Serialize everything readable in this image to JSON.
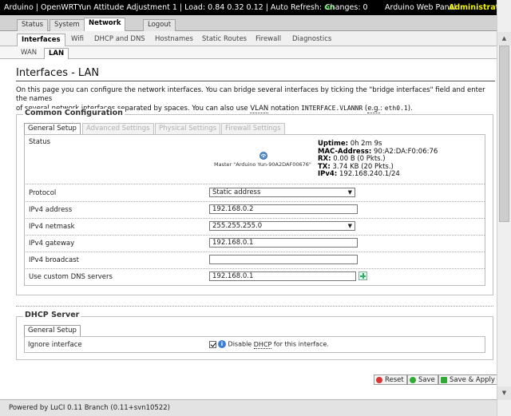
{
  "header": {
    "left_text": "Arduino | OpenWRTYun Attitude Adjustment 1 | Load: 0.84 0.32 0.12 | Auto Refresh: ",
    "auto_refresh": "on",
    "changes": "Changes: 0",
    "panel_name": "Arduino Web Panel",
    "admin_label": "Administration"
  },
  "main_tabs": [
    "Status",
    "System",
    "Network",
    "Logout"
  ],
  "sub_tabs": [
    "Interfaces",
    "Wifi",
    "DHCP and DNS",
    "Hostnames",
    "Static Routes",
    "Firewall",
    "Diagnostics"
  ],
  "iface_tabs": [
    "WAN",
    "LAN"
  ],
  "page": {
    "title": "Interfaces - LAN",
    "desc_line1": "On this page you can configure the network interfaces. You can bridge several interfaces by ticking the \"bridge interfaces\" field and enter the names",
    "desc_line2a": "of several network interfaces separated by spaces. You can also use ",
    "desc_vlan": "VLAN",
    "desc_line2b": " notation ",
    "desc_notation": "INTERFACE.VLANNR",
    "desc_line2c": " (",
    "desc_eg": "e.g.",
    "desc_line2d": ": ",
    "desc_example": "eth0.1",
    "desc_line2e": ")."
  },
  "common": {
    "legend": "Common Configuration",
    "tabs": [
      "General Setup",
      "Advanced Settings",
      "Physical Settings",
      "Firewall Settings"
    ],
    "status": {
      "label": "Status",
      "device": "Master \"Arduino Yun-90A2DAF00676\"",
      "uptime_label": "Uptime:",
      "uptime": "0h 2m 9s",
      "mac_label": "MAC-Address:",
      "mac": "90:A2:DA:F0:06:76",
      "rx_label": "RX:",
      "rx": "0.00 B (0 Pkts.)",
      "tx_label": "TX:",
      "tx": "3.74 KB (20 Pkts.)",
      "ipv4_label": "IPv4:",
      "ipv4": "192.168.240.1/24"
    },
    "protocol": {
      "label": "Protocol",
      "value": "Static address"
    },
    "ipv4_address": {
      "label": "IPv4 address",
      "value": "192.168.0.2"
    },
    "ipv4_netmask": {
      "label": "IPv4 netmask",
      "value": "255.255.255.0"
    },
    "ipv4_gateway": {
      "label": "IPv4 gateway",
      "value": "192.168.0.1"
    },
    "ipv4_broadcast": {
      "label": "IPv4 broadcast",
      "value": ""
    },
    "dns": {
      "label": "Use custom DNS servers",
      "value": "192.168.0.1"
    }
  },
  "dhcp": {
    "legend": "DHCP Server",
    "tab": "General Setup",
    "ignore_label": "Ignore interface",
    "disable_text_a": "Disable ",
    "disable_dhcp": "DHCP",
    "disable_text_b": " for this interface."
  },
  "buttons": {
    "reset": "Reset",
    "save": "Save",
    "save_apply": "Save & Apply"
  },
  "footer": {
    "powered": "Powered by LuCI 0.11 Branch (0.11+svn10522)"
  },
  "colors": {
    "auto_refresh_on": "#32d532",
    "admin": "#f4f400"
  }
}
